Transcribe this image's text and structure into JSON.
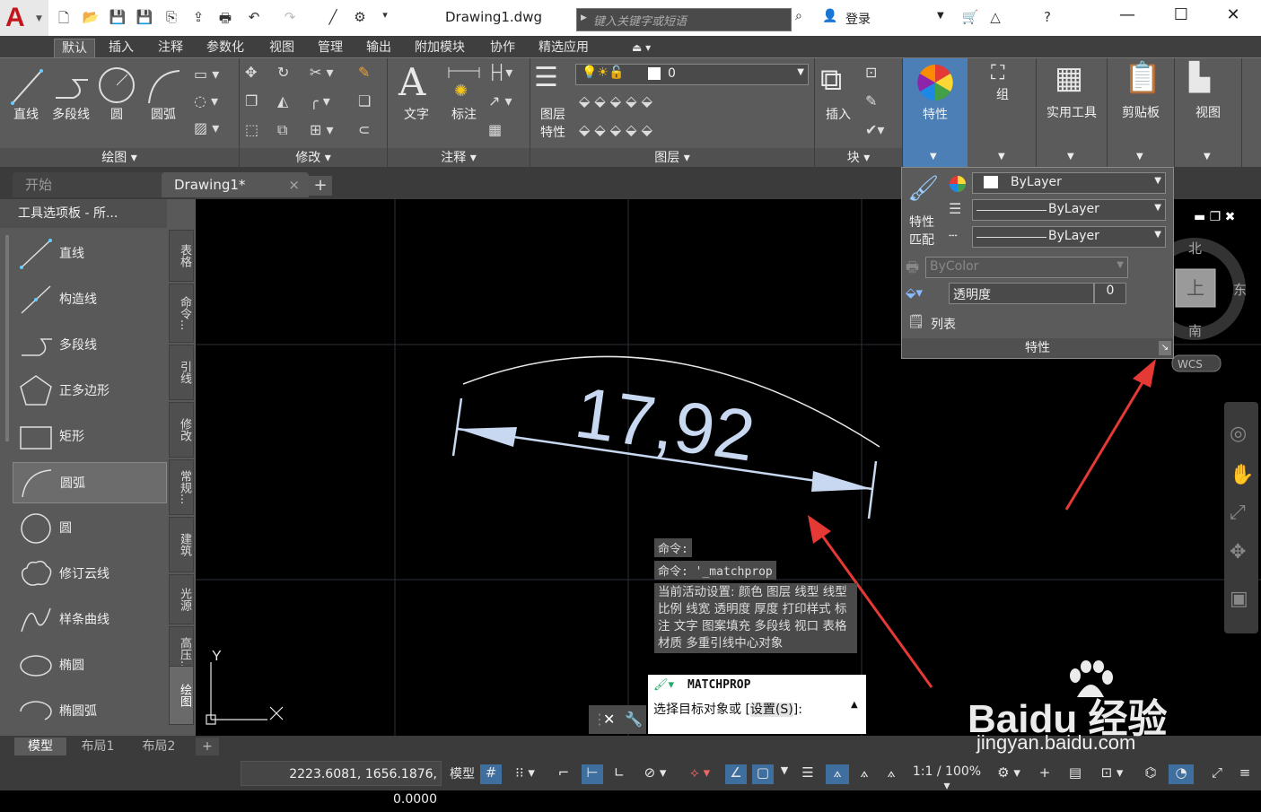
{
  "title_bar": {
    "app_logo": "A",
    "document_title": "Drawing1.dwg",
    "search_placeholder": "键入关键字或短语",
    "login_label": "登录",
    "minimize": "—",
    "maximize": "☐",
    "close": "✕"
  },
  "ribbon_tabs": [
    "默认",
    "插入",
    "注释",
    "参数化",
    "视图",
    "管理",
    "输出",
    "附加模块",
    "协作",
    "精选应用"
  ],
  "ribbon": {
    "draw": {
      "title": "绘图",
      "line": "直线",
      "polyline": "多段线",
      "circle": "圆",
      "arc": "圆弧"
    },
    "modify": {
      "title": "修改"
    },
    "annotation": {
      "title": "注释",
      "text": "文字",
      "dimension": "标注"
    },
    "layers": {
      "title": "图层",
      "layer_props_line1": "图层",
      "layer_props_line2": "特性",
      "current_layer": "0"
    },
    "block": {
      "title": "块",
      "insert": "插入"
    },
    "properties": {
      "label": "特性"
    },
    "group": {
      "label": "组"
    },
    "utilities": {
      "label": "实用工具"
    },
    "clipboard": {
      "label": "剪贴板"
    },
    "view": {
      "label": "视图"
    }
  },
  "properties_panel": {
    "match_line1": "特性",
    "match_line2": "匹配",
    "color": "ByLayer",
    "linetype": "ByLayer",
    "lineweight": "ByLayer",
    "plotstyle": "ByColor",
    "transparency_label": "透明度",
    "transparency_value": "0",
    "list_label": "列表",
    "footer": "特性"
  },
  "doc_tabs": {
    "start": "开始",
    "drawing": "Drawing1*",
    "close": "×",
    "add": "+"
  },
  "palette": {
    "title": "工具选项板 - 所...",
    "items": [
      "直线",
      "构造线",
      "多段线",
      "正多边形",
      "矩形",
      "圆弧",
      "圆",
      "修订云线",
      "样条曲线",
      "椭圆",
      "椭圆弧"
    ],
    "selected": "圆弧",
    "side_tabs": [
      "表格",
      "命令...",
      "引线",
      "修改",
      "常规...",
      "建筑",
      "光源",
      "高压...",
      "绘图"
    ]
  },
  "drawing": {
    "dimension_text": "17,92",
    "ucs_y": "Y",
    "viewcube": {
      "north": "北",
      "east": "东",
      "south": "南",
      "top": "上",
      "wcs": "WCS"
    }
  },
  "command_history": [
    "命令:",
    "命令: '_matchprop",
    "当前活动设置:  颜色 图层 线型 线型比例 线宽 透明度 厚度 打印样式 标注 文字 图案填充 多段线 视口 表格材质 多重引线中心对象"
  ],
  "command_prompt": {
    "command": "MATCHPROP",
    "prompt": "选择目标对象或 [",
    "option": "设置(S)",
    "suffix": "]:"
  },
  "layout_tabs": {
    "model": "模型",
    "layout1": "布局1",
    "layout2": "布局2",
    "add": "+"
  },
  "status_bar": {
    "coords": "2223.6081, 1656.1876, 0.0000",
    "model": "模型",
    "scale": "1:1 / 100%"
  },
  "watermark": {
    "brand": "Baidu 经验",
    "url": "jingyan.baidu.com"
  },
  "colors": {
    "accent": "#4c7fb5",
    "arrow": "#e53935",
    "dimension": "#c8d8f0"
  }
}
